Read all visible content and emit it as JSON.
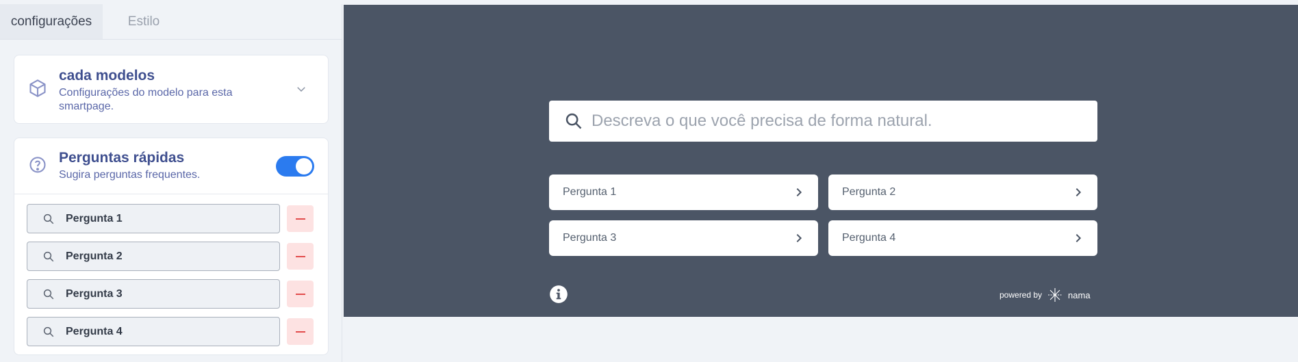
{
  "tabs": [
    {
      "label": "configurações"
    },
    {
      "label": "Estilo"
    }
  ],
  "models_card": {
    "title": "cada modelos",
    "subtitle_line1": "Configurações do modelo para esta",
    "subtitle_line2": "smartpage."
  },
  "quick_card": {
    "title": "Perguntas rápidas",
    "subtitle": "Sugira perguntas frequentes.",
    "toggle_on": true,
    "questions": [
      {
        "label": "Pergunta 1"
      },
      {
        "label": "Pergunta 2"
      },
      {
        "label": "Pergunta 3"
      },
      {
        "label": "Pergunta 4"
      }
    ]
  },
  "preview": {
    "search_placeholder": "Descreva o que você precisa de forma natural.",
    "buttons": [
      {
        "label": "Pergunta 1"
      },
      {
        "label": "Pergunta 2"
      },
      {
        "label": "Pergunta 3"
      },
      {
        "label": "Pergunta 4"
      }
    ],
    "powered_by": "powered by",
    "brand": "nama"
  },
  "colors": {
    "accent": "#2b7bef",
    "preview_bg": "#4b5565",
    "title": "#3f4f8f",
    "remove_bg": "#fde2e2",
    "remove_line": "#e24c4c"
  }
}
